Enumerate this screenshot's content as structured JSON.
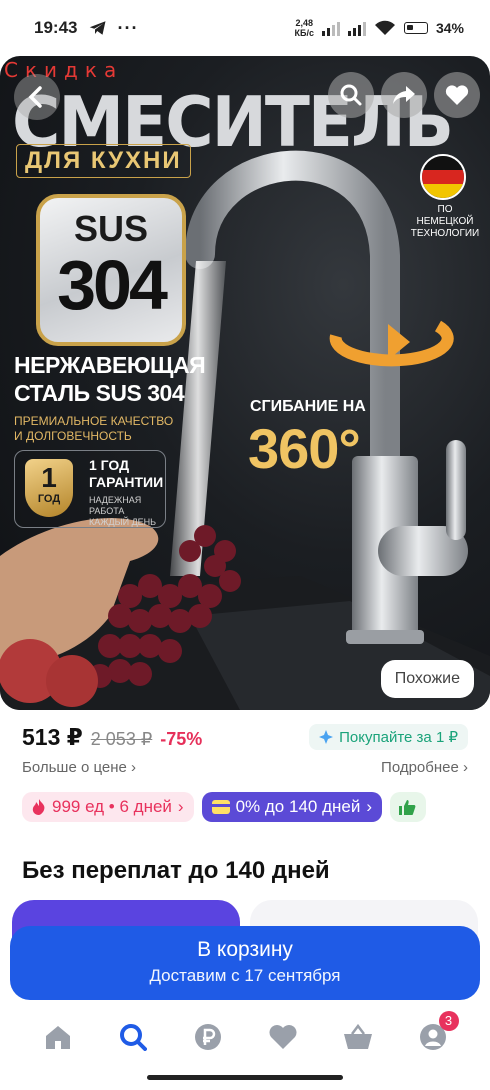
{
  "status": {
    "time": "19:43",
    "net_speed_value": "2,48",
    "net_speed_unit": "КБ/с",
    "battery": "34%"
  },
  "hero": {
    "sale_label": "Скидка",
    "promo_title": "СМЕСИТЕЛЬ",
    "promo_subtitle": "ДЛЯ КУХНИ",
    "badge_line1": "SUS",
    "badge_line2": "304",
    "steel_line1": "НЕРЖАВЕЮЩАЯ",
    "steel_line2": "СТАЛЬ SUS 304",
    "quality_line1": "ПРЕМИАЛЬНОЕ КАЧЕСТВО",
    "quality_line2": "И ДОЛГОВЕЧНОСТЬ",
    "warranty_num": "1",
    "warranty_unit": "ГОД",
    "warranty_title1": "1 ГОД",
    "warranty_title2": "ГАРАНТИИ",
    "warranty_note1": "НАДЕЖНАЯ РАБОТА",
    "warranty_note2": "КАЖДЫЙ ДЕНЬ",
    "flag_caption1": "ПО НЕМЕЦКОЙ",
    "flag_caption2": "ТЕХНОЛОГИИ",
    "bend_text": "СГИБАНИЕ НА",
    "bend_degrees": "360°",
    "similar_button": "Похожие"
  },
  "price": {
    "current": "513 ₽",
    "old": "2 053 ₽",
    "discount": "-75%",
    "buy_for": "Покупайте за 1 ₽",
    "more_about_price": "Больше о цене",
    "more_details": "Подробнее"
  },
  "chips": {
    "points": "999 ед • 6 дней",
    "installment": "0% до 140 дней"
  },
  "section_title": "Без переплат до 140 дней",
  "cart": {
    "label": "В корзину",
    "delivery": "Доставим с 17 сентября"
  },
  "nav": {
    "profile_badge": "3"
  },
  "colors": {
    "accent_blue": "#1f5be6",
    "chip_purple": "#5b4ad6",
    "discount_pink": "#e6305a",
    "gold": "#f0c463"
  }
}
